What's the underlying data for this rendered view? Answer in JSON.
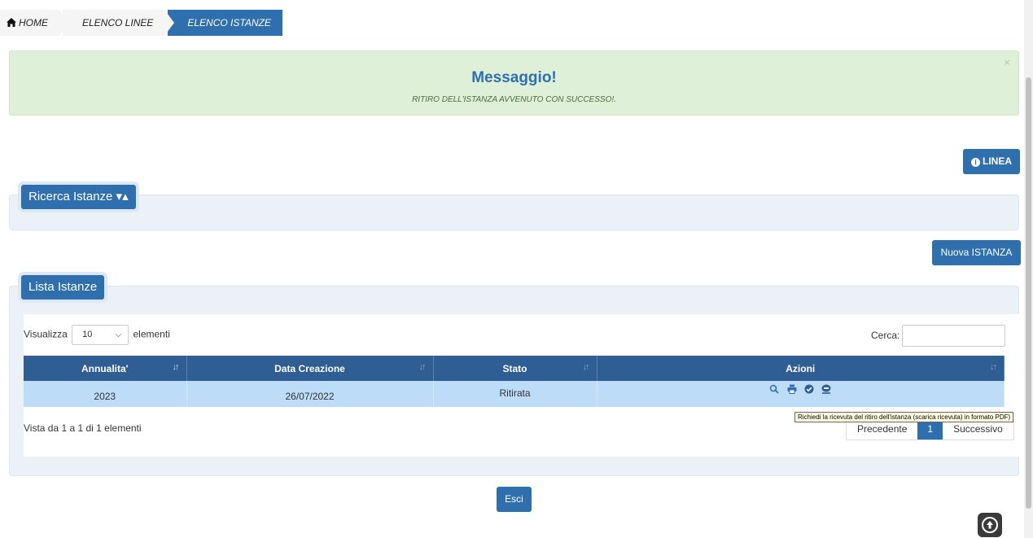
{
  "breadcrumb": {
    "home": "HOME",
    "linee": "ELENCO LINEE",
    "istanze": "ELENCO ISTANZE"
  },
  "alert": {
    "title": "Messaggio!",
    "message": "RITIRO DELL'ISTANZA AVVENUTO CON SUCCESSO!.",
    "close": "×",
    "bg_color": "#dff0d8"
  },
  "buttons": {
    "linea": "LINEA",
    "nuova_istanza": "Nuova ISTANZA",
    "esci": "Esci"
  },
  "ricerca": {
    "tab_label": "Ricerca Istanze ▾▴"
  },
  "lista": {
    "tab_label": "Lista Istanze",
    "visualizza_label": "Visualizza",
    "page_size": "10",
    "elementi_label": "elementi",
    "cerca_label": "Cerca:",
    "columns": [
      "Annualita'",
      "Data Creazione",
      "Stato",
      "Azioni"
    ],
    "rows": [
      {
        "annualita": "2023",
        "data_creazione": "26/07/2022",
        "stato": "Ritirata"
      }
    ],
    "row_actions": [
      "search-icon",
      "print-icon",
      "check-circle-icon",
      "download-receipt-icon"
    ],
    "info": "Vista da 1 a 1 di 1 elementi",
    "pager": {
      "prev": "Precedente",
      "current": "1",
      "next": "Successivo"
    }
  },
  "tooltip": "Richiedi la ricevuta del ritiro dell'istanza (scarica ricevuta) in formato PDF)",
  "colors": {
    "primary": "#2f6fae",
    "header": "#2f5e94",
    "row_selected": "#bcdcf8"
  }
}
